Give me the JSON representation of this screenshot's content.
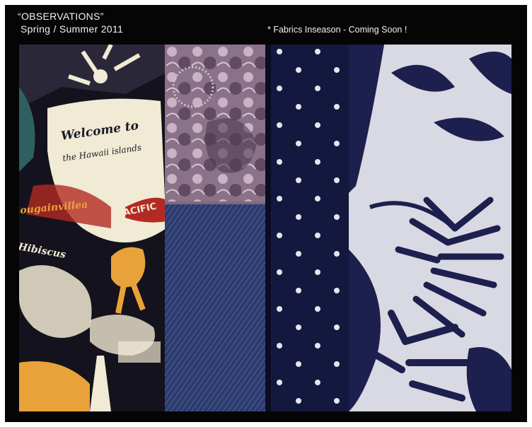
{
  "header": {
    "title": "“OBSERVATIONS”",
    "season": "Spring / Summer 2011",
    "note": "* Fabrics Inseason - Coming Soon !"
  },
  "swatches": [
    {
      "name": "hawaiian-print-fabric",
      "printed_text": [
        "Welcome to",
        "the Hawaii islands",
        "PACIFIC",
        "Bougainvillea",
        "Hibiscus"
      ],
      "colors": {
        "base": "#14121c",
        "accent": "#e9a23a",
        "cream": "#f1ead4",
        "teal": "#2f5f61",
        "red": "#b32a23"
      }
    },
    {
      "name": "paisley-floral-fabric",
      "colors": {
        "base": "#8b7289",
        "light": "#c9b3c4",
        "dark": "#4f3a52"
      }
    },
    {
      "name": "denim-fabric",
      "colors": {
        "base": "#2b3a6b",
        "light": "#3f4f85"
      }
    },
    {
      "name": "polka-dot-fabric",
      "colors": {
        "base": "#14183f",
        "dot": "#e4e6ee"
      }
    },
    {
      "name": "palm-leaf-print-fabric",
      "colors": {
        "base": "#d9d9e3",
        "leaf": "#1d1f4e"
      }
    }
  ]
}
